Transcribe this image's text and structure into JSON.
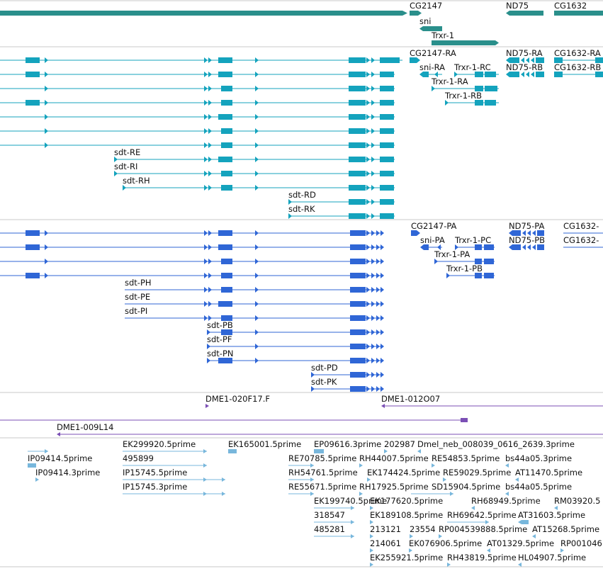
{
  "colors": {
    "gene": "#2a8f8b",
    "transcript": "#14a3bd",
    "protein": "#2f66d6",
    "match": "#7b4fb5",
    "est": "#78b7dc",
    "divider": "#c8c8c8"
  },
  "gene_labels": {
    "cg2147": "CG2147",
    "sni": "sni",
    "trxr1": "Trxr-1",
    "nd75": "ND75",
    "cg1632": "CG1632"
  },
  "transcript_labels": {
    "cg2147_ra": "CG2147-RA",
    "nd75_ra": "ND75-RA",
    "cg1632_ra": "CG1632-RA",
    "sni_ra": "sni-RA",
    "trxr1_rc": "Trxr-1-RC",
    "nd75_rb": "ND75-RB",
    "cg1632_rb": "CG1632-RB",
    "trxr1_ra": "Trxr-1-RA",
    "trxr1_rb": "Trxr-1-RB",
    "sdt_re": "sdt-RE",
    "sdt_ri": "sdt-RI",
    "sdt_rh": "sdt-RH",
    "sdt_rd": "sdt-RD",
    "sdt_rk": "sdt-RK"
  },
  "protein_labels": {
    "cg2147_pa": "CG2147-PA",
    "nd75_pa": "ND75-PA",
    "cg1632_pa": "CG1632-",
    "sni_pa": "sni-PA",
    "trxr1_pc": "Trxr-1-PC",
    "nd75_pb": "ND75-PB",
    "cg1632_pb": "CG1632-",
    "trxr1_pa": "Trxr-1-PA",
    "trxr1_pb": "Trxr-1-PB",
    "sdt_ph": "sdt-PH",
    "sdt_pe": "sdt-PE",
    "sdt_pi": "sdt-PI",
    "sdt_pb": "sdt-PB",
    "sdt_pf": "sdt-PF",
    "sdt_pn": "sdt-PN",
    "sdt_pd": "sdt-PD",
    "sdt_pk": "sdt-PK"
  },
  "match_labels": {
    "dme1_020f17": "DME1-020F17.F",
    "dme1_012o07": "DME1-012O07",
    "dme1_009l14": "DME1-009L14"
  },
  "est_labels": {
    "ip09414_5": "IP09414.5prime",
    "ip09414_3": "IP09414.3prime",
    "ek299920": "EK299920.5prime",
    "n495899": "495899",
    "ip15745_5": "IP15745.5prime",
    "ip15745_3": "IP15745.3prime",
    "ek165001": "EK165001.5prime",
    "ep09616": "EP09616.3prime",
    "n202987": "202987",
    "dmel_neb": "Dmel_neb_008039_0616_2639.3prime",
    "re70785": "RE70785.5prime",
    "rh44007": "RH44007.5prime",
    "re54853": "RE54853.5prime",
    "bs44a05_3": "bs44a05.3prime",
    "rh54761": "RH54761.5prime",
    "ek174424": "EK174424.5prime",
    "re59029": "RE59029.5prime",
    "at11470": "AT11470.5prime",
    "re55671": "RE55671.5prime",
    "rh17925": "RH17925.5prime",
    "sd15904": "SD15904.5prime",
    "bs44a05_5": "bs44a05.5prime",
    "ek199740": "EK199740.5prime",
    "ek177620": "EK177620.5prime",
    "rh68949": "RH68949.5prime",
    "rm03920": "RM03920.5",
    "n318547": "318547",
    "ek189108": "EK189108.5prime",
    "rh69642": "RH69642.5prime",
    "at31603": "AT31603.5prime",
    "n485281": "485281",
    "n213121": "213121",
    "n23554": "23554",
    "rp004539888": "RP004539888.5prime",
    "at15268": "AT15268.5prime",
    "n214061": "214061",
    "ek076906": "EK076906.5prime",
    "at01329": "AT01329.5prime",
    "rp001046": "RP001046",
    "ek255921": "EK255921.5prime",
    "rh43819": "RH43819.5prime",
    "hl04907": "HL04907.5prime"
  }
}
